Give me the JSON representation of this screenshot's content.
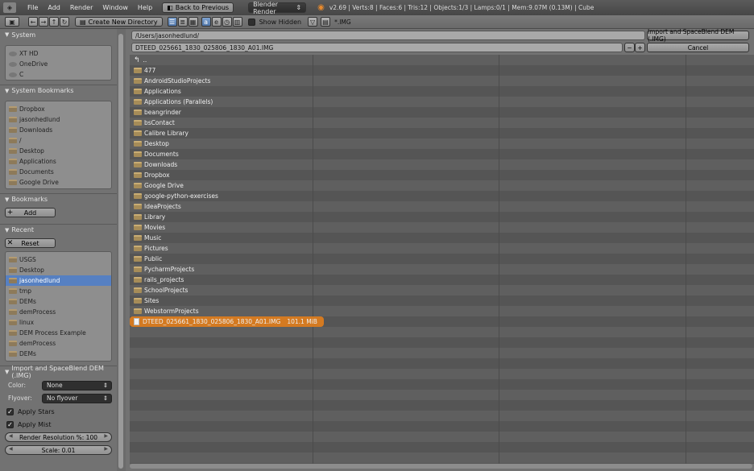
{
  "topbar": {
    "menus": [
      "File",
      "Add",
      "Render",
      "Window",
      "Help"
    ],
    "back_button": "Back to Previous",
    "render_engine": "Blender Render",
    "info": "v2.69 | Verts:8 | Faces:6 | Tris:12 | Objects:1/3 | Lamps:0/1 | Mem:9.07M (0.13M) | Cube"
  },
  "toolbar": {
    "create_dir": "Create New Directory",
    "show_hidden": "Show Hidden",
    "filter_text": "*.IMG"
  },
  "sidebar": {
    "system": {
      "title": "System",
      "items": [
        "XT HD",
        "OneDrive",
        "C"
      ]
    },
    "system_bookmarks": {
      "title": "System Bookmarks",
      "items": [
        "Dropbox",
        "jasonhedlund",
        "Downloads",
        "/",
        "Desktop",
        "Applications",
        "Documents",
        "Google Drive"
      ]
    },
    "bookmarks": {
      "title": "Bookmarks",
      "add_label": "Add"
    },
    "recent": {
      "title": "Recent",
      "reset_label": "Reset",
      "items": [
        "USGS",
        "Desktop",
        "jasonhedlund",
        "tmp",
        "DEMs",
        "demProcess",
        "linux",
        "DEM Process Example",
        "demProcess",
        "DEMs"
      ],
      "selected_index": 2
    },
    "import_panel": {
      "title": "Import and SpaceBlend DEM (.IMG)",
      "color_label": "Color:",
      "color_value": "None",
      "flyover_label": "Flyover:",
      "flyover_value": "No flyover",
      "apply_stars": "Apply Stars",
      "apply_mist": "Apply Mist",
      "render_resolution": "Render Resolution %: 100",
      "scale": "Scale: 0.01"
    }
  },
  "main": {
    "path": "/Users/jasonhedlund/",
    "filename": "DTEED_025661_1830_025806_1830_A01.IMG",
    "import_button": "Import and SpaceBlend DEM (.IMG)",
    "cancel_button": "Cancel",
    "parent_dir": "..",
    "folders": [
      "477",
      "AndroidStudioProjects",
      "Applications",
      "Applications (Parallels)",
      "beangrinder",
      "bsContact",
      "Calibre Library",
      "Desktop",
      "Documents",
      "Downloads",
      "Dropbox",
      "Google Drive",
      "google-python-exercises",
      "IdeaProjects",
      "Library",
      "Movies",
      "Music",
      "Pictures",
      "Public",
      "PycharmProjects",
      "rails_projects",
      "SchoolProjects",
      "Sites",
      "WebstormProjects"
    ],
    "selected_file": {
      "name": "DTEED_025661_1830_025806_1830_A01.IMG",
      "size": "101.1 MiB"
    }
  }
}
